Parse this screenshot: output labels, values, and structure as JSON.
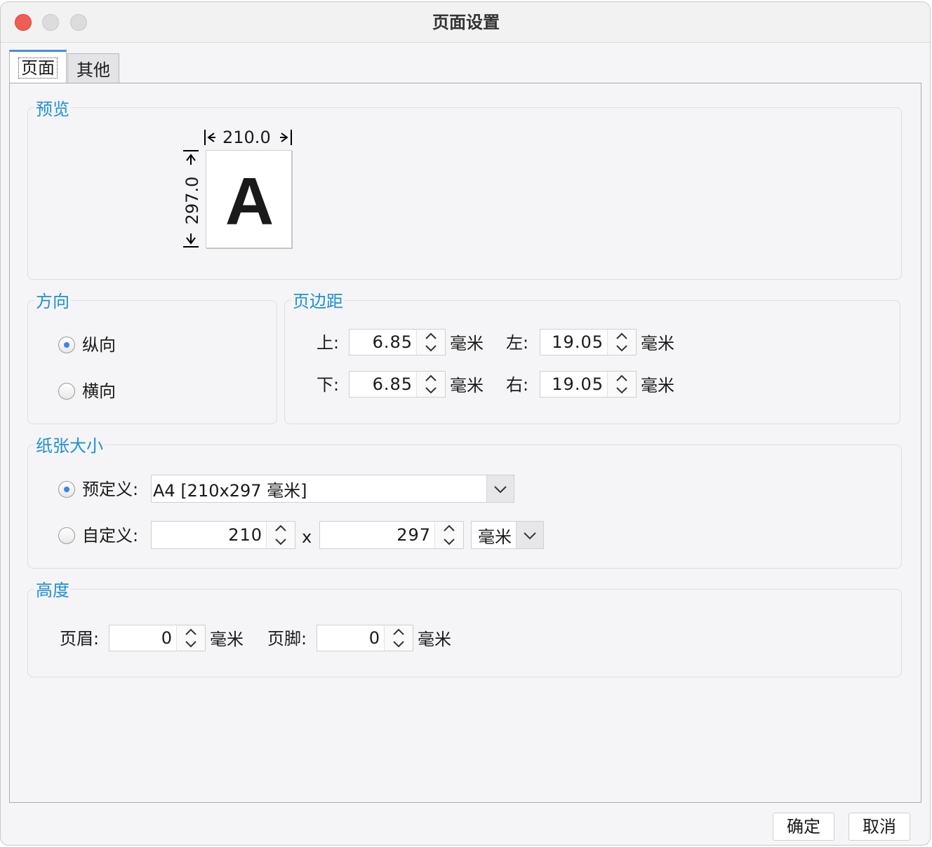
{
  "window": {
    "title": "页面设置"
  },
  "tabs": [
    {
      "label": "页面",
      "active": true
    },
    {
      "label": "其他",
      "active": false
    }
  ],
  "preview": {
    "group_label": "预览",
    "width_label": "210.0",
    "height_label": "297.0",
    "sample_letter": "A"
  },
  "orientation": {
    "group_label": "方向",
    "options": [
      {
        "label": "纵向",
        "selected": true
      },
      {
        "label": "横向",
        "selected": false
      }
    ]
  },
  "margins": {
    "group_label": "页边距",
    "unit": "毫米",
    "top": {
      "label": "上:",
      "value": "6.85"
    },
    "bottom": {
      "label": "下:",
      "value": "6.85"
    },
    "left": {
      "label": "左:",
      "value": "19.05"
    },
    "right": {
      "label": "右:",
      "value": "19.05"
    }
  },
  "paper_size": {
    "group_label": "纸张大小",
    "predefined": {
      "label": "预定义:",
      "selected": true,
      "value": "A4 [210x297 毫米]"
    },
    "custom": {
      "label": "自定义:",
      "selected": false,
      "width": "210",
      "times": "x",
      "height": "297",
      "unit": "毫米"
    }
  },
  "height": {
    "group_label": "高度",
    "unit": "毫米",
    "header": {
      "label": "页眉:",
      "value": "0"
    },
    "footer": {
      "label": "页脚:",
      "value": "0"
    }
  },
  "buttons": {
    "ok": "确定",
    "cancel": "取消"
  },
  "colors": {
    "accent": "#1f8fd6",
    "radio_selected": "#3b82f6",
    "close": "#ee5e55"
  },
  "icons": [
    "close-window-icon",
    "spinner-up-icon",
    "spinner-down-icon",
    "dropdown-chevron-icon"
  ]
}
